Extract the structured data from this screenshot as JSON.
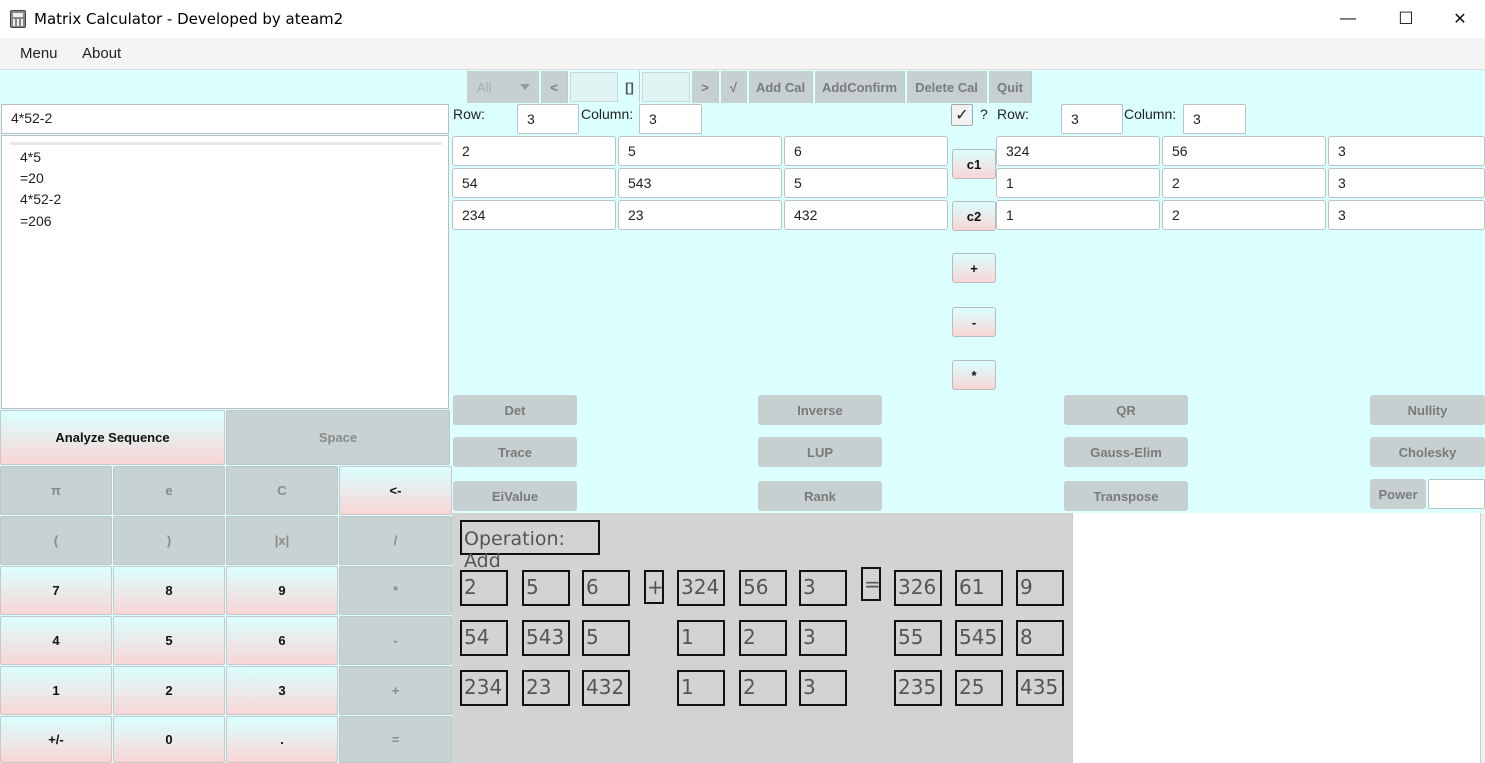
{
  "window": {
    "title": "Matrix Calculator - Developed by ateam2",
    "minimize": "—",
    "maximize": "☐",
    "close": "✕"
  },
  "menu": [
    "Menu",
    "About"
  ],
  "toolbar": {
    "filter_value": "All",
    "prev": "<",
    "bracket": "[]",
    "next": ">",
    "sqrt": "√",
    "add_cal": "Add Cal",
    "add_confirm": "AddConfirm",
    "delete_cal": "Delete Cal",
    "quit": "Quit"
  },
  "expression": "4*52-2",
  "history": [
    "4*5",
    "=20",
    "4*52-2",
    "=206"
  ],
  "keypad": {
    "analyze": "Analyze Sequence",
    "space": "Space",
    "rows": [
      [
        "π",
        "e",
        "C",
        "<-"
      ],
      [
        "(",
        ")",
        "|x|",
        "/"
      ],
      [
        "7",
        "8",
        "9",
        "*"
      ],
      [
        "4",
        "5",
        "6",
        "-"
      ],
      [
        "1",
        "2",
        "3",
        "+"
      ],
      [
        "+/-",
        "0",
        ".",
        "="
      ]
    ]
  },
  "matrix_left": {
    "row_label": "Row:",
    "row_value": "3",
    "col_label": "Column:",
    "col_value": "3",
    "cells": [
      [
        "2",
        "5",
        "6"
      ],
      [
        "54",
        "543",
        "5"
      ],
      [
        "234",
        "23",
        "432"
      ]
    ]
  },
  "middle_buttons": [
    "c1",
    "c2",
    "+",
    "-",
    "*"
  ],
  "matrix_right": {
    "checkbox_mark": "✓",
    "question": "?",
    "row_label": "Row:",
    "row_value": "3",
    "col_label": "Column:",
    "col_value": "3",
    "cells": [
      [
        "324",
        "56",
        "3"
      ],
      [
        "1",
        "2",
        "3"
      ],
      [
        "1",
        "2",
        "3"
      ]
    ]
  },
  "functions": [
    [
      "Det",
      "Inverse",
      "QR",
      "Nullity"
    ],
    [
      "Trace",
      "LUP",
      "Gauss-Elim",
      "Cholesky"
    ],
    [
      "EiValue",
      "Rank",
      "Transpose",
      "Power"
    ]
  ],
  "result": {
    "operation": "Operation: Add",
    "plus": "+",
    "equals": "=",
    "a": [
      [
        "2",
        "5",
        "6"
      ],
      [
        "54",
        "543",
        "5"
      ],
      [
        "234",
        "23",
        "432"
      ]
    ],
    "b": [
      [
        "324",
        "56",
        "3"
      ],
      [
        "1",
        "2",
        "3"
      ],
      [
        "1",
        "2",
        "3"
      ]
    ],
    "c": [
      [
        "326",
        "61",
        "9"
      ],
      [
        "55",
        "545",
        "8"
      ],
      [
        "235",
        "25",
        "435"
      ]
    ]
  }
}
